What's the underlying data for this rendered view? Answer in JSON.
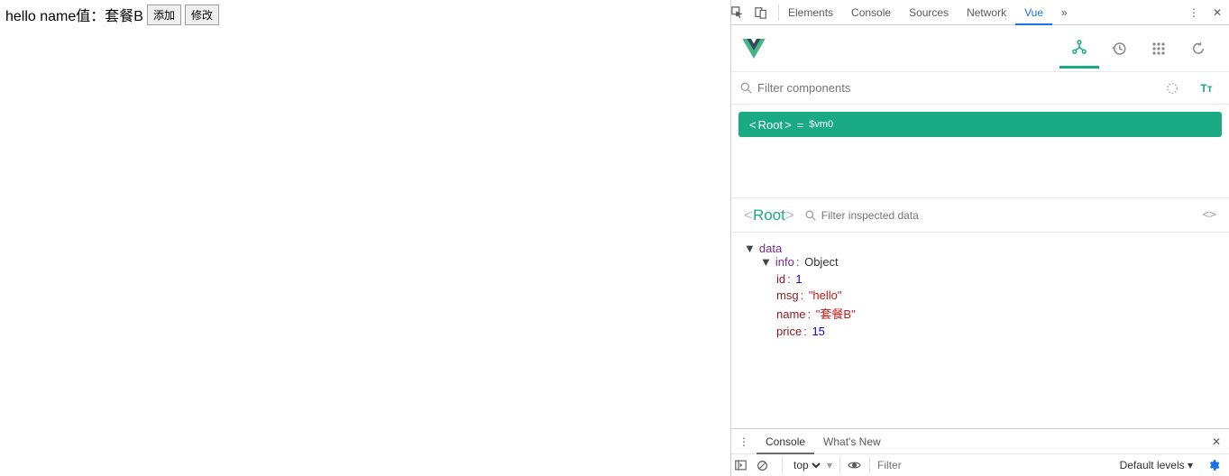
{
  "page": {
    "text": "hello name值：套餐B",
    "buttons": {
      "add": "添加",
      "edit": "修改"
    }
  },
  "devtools": {
    "tabs": {
      "elements": "Elements",
      "console": "Console",
      "sources": "Sources",
      "network": "Network",
      "vue": "Vue",
      "more": "»"
    },
    "filterComponents": {
      "placeholder": "Filter components"
    },
    "componentRow": {
      "open": "<",
      "name": "Root",
      "close": ">",
      "eq": "=",
      "vm": "$vm0"
    },
    "inspected": {
      "open": "<",
      "name": "Root",
      "close": ">",
      "filterPlaceholder": "Filter inspected data",
      "braces": "<>"
    },
    "dataPanel": {
      "section": "data",
      "infoKey": "info",
      "infoType": "Object",
      "props": {
        "id": {
          "key": "id",
          "val": "1"
        },
        "msg": {
          "key": "msg",
          "val": "\"hello\""
        },
        "name": {
          "key": "name",
          "val": "\"套餐B\""
        },
        "price": {
          "key": "price",
          "val": "15"
        }
      }
    },
    "console": {
      "tabs": {
        "console": "Console",
        "whatsnew": "What's New"
      },
      "context": "top",
      "filterPlaceholder": "Filter",
      "levels": "Default levels ▾"
    }
  }
}
